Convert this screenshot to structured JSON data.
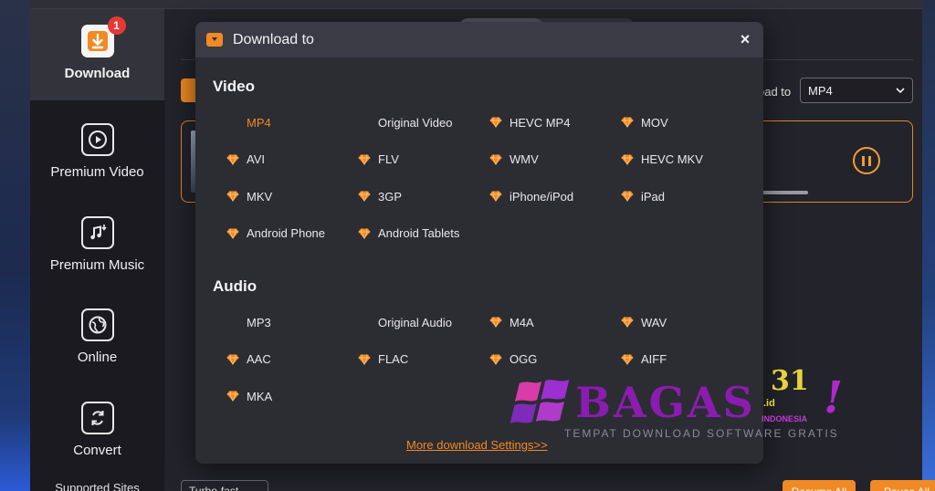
{
  "sidebar": {
    "items": [
      {
        "label": "Download",
        "icon": "download-icon",
        "badge": "1",
        "active": true
      },
      {
        "label": "Premium Video",
        "icon": "play-icon"
      },
      {
        "label": "Premium Music",
        "icon": "music-note-icon"
      },
      {
        "label": "Online",
        "icon": "globe-icon"
      },
      {
        "label": "Convert",
        "icon": "convert-icon"
      }
    ],
    "bottom_label": "Supported Sites"
  },
  "main": {
    "download_to_label": "oad to",
    "format_value": "MP4",
    "bottom_select": "Turbo-fast",
    "resume_all": "Resume All",
    "pause_all": "Pause All"
  },
  "modal": {
    "title": "Download to",
    "close": "×",
    "video_title": "Video",
    "audio_title": "Audio",
    "video_options": [
      {
        "label": "MP4",
        "premium": false,
        "selected": true
      },
      {
        "label": "Original Video",
        "premium": false
      },
      {
        "label": "HEVC MP4",
        "premium": true
      },
      {
        "label": "MOV",
        "premium": true
      },
      {
        "label": "AVI",
        "premium": true
      },
      {
        "label": "FLV",
        "premium": true
      },
      {
        "label": "WMV",
        "premium": true
      },
      {
        "label": "HEVC MKV",
        "premium": true
      },
      {
        "label": "MKV",
        "premium": true
      },
      {
        "label": "3GP",
        "premium": true
      },
      {
        "label": "iPhone/iPod",
        "premium": true
      },
      {
        "label": "iPad",
        "premium": true
      },
      {
        "label": "Android Phone",
        "premium": true
      },
      {
        "label": "Android Tablets",
        "premium": true
      }
    ],
    "audio_options": [
      {
        "label": "MP3",
        "premium": false
      },
      {
        "label": "Original Audio",
        "premium": false
      },
      {
        "label": "M4A",
        "premium": true
      },
      {
        "label": "WAV",
        "premium": true
      },
      {
        "label": "AAC",
        "premium": true
      },
      {
        "label": "FLAC",
        "premium": true
      },
      {
        "label": "OGG",
        "premium": true
      },
      {
        "label": "AIFF",
        "premium": true
      },
      {
        "label": "MKA",
        "premium": true
      }
    ],
    "more_link": "More download Settings>>"
  },
  "watermark": {
    "brand": "BAGAS",
    "number": "31",
    "domain": ".id",
    "country": "INDONESIA",
    "tagline": "TEMPAT DOWNLOAD SOFTWARE GRATIS",
    "mark": "!"
  },
  "colors": {
    "accent": "#f08a24",
    "modal_bg": "#2c2c33",
    "header_bg": "#3b3b45"
  }
}
